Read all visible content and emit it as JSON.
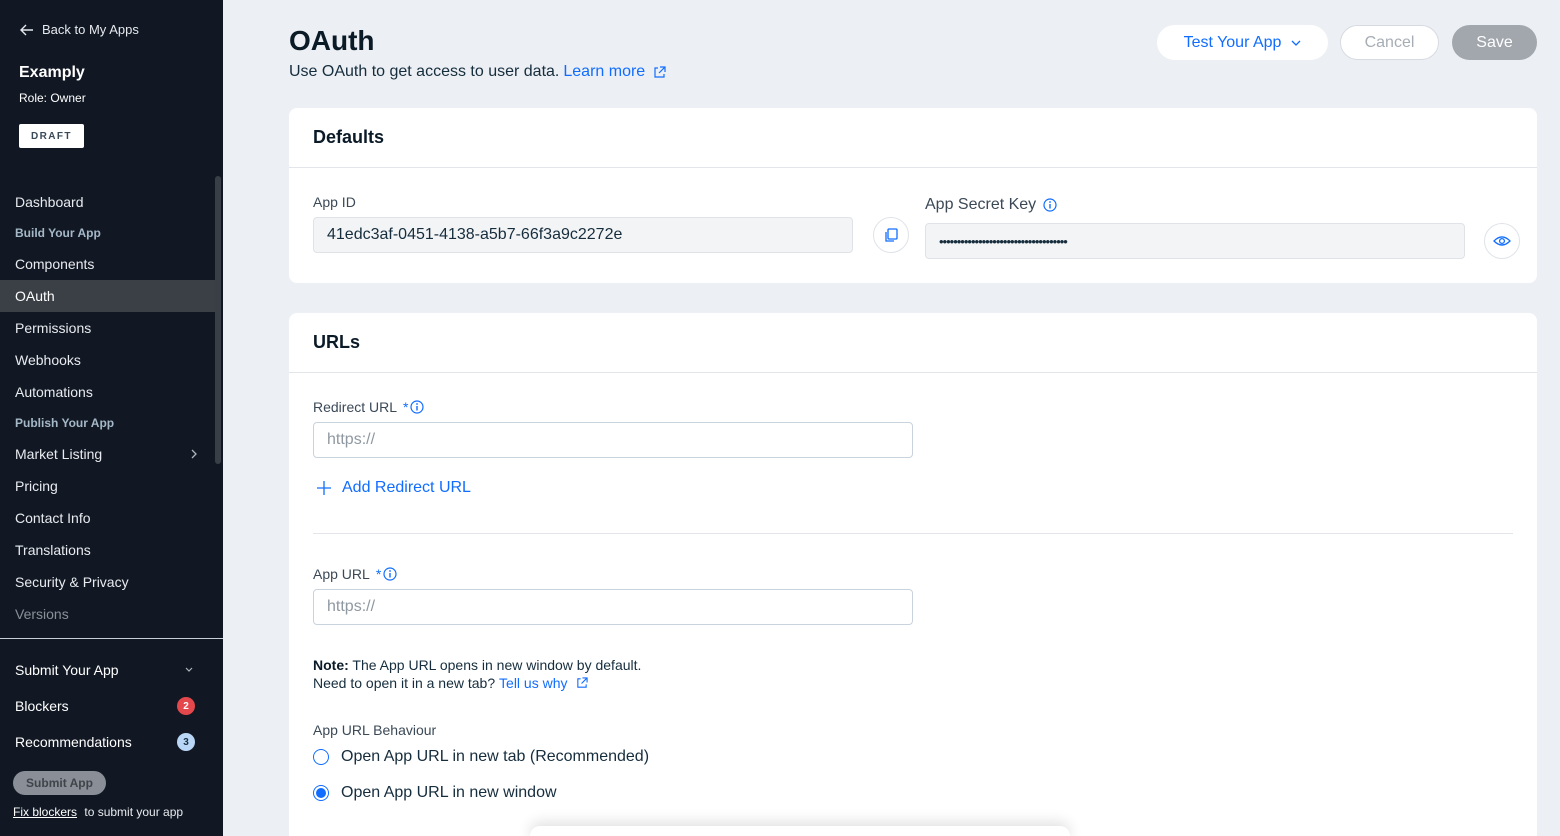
{
  "sidebar": {
    "back_label": "Back to My Apps",
    "app_name": "Examply",
    "role": "Role: Owner",
    "status_badge": "DRAFT",
    "dashboard": "Dashboard",
    "section_build": "Build Your App",
    "items_build": [
      "Components",
      "OAuth",
      "Permissions",
      "Webhooks",
      "Automations"
    ],
    "section_publish": "Publish Your App",
    "items_publish": [
      "Market Listing",
      "Pricing",
      "Contact Info",
      "Translations",
      "Security & Privacy",
      "Versions"
    ],
    "active_item": "OAuth",
    "submit_your_app": "Submit Your App",
    "blockers_label": "Blockers",
    "blockers_count": "2",
    "recommendations_label": "Recommendations",
    "recommendations_count": "3",
    "submit_button": "Submit App",
    "fix_blockers_link": "Fix blockers",
    "fix_blockers_suffix": "to submit your app"
  },
  "header": {
    "title": "OAuth",
    "subtitle": "Use OAuth to get access to user data.",
    "learn_more": "Learn more",
    "test_button": "Test Your App",
    "cancel_button": "Cancel",
    "save_button": "Save"
  },
  "defaults_card": {
    "title": "Defaults",
    "app_id_label": "App ID",
    "app_id_value": "41edc3af-0451-4138-a5b7-66f3a9c2272e",
    "secret_label": "App Secret Key",
    "secret_value": "••••••••••••••••••••••••••••••••••••"
  },
  "urls_card": {
    "title": "URLs",
    "redirect_label": "Redirect URL",
    "required_mark": "*",
    "redirect_placeholder": "https://",
    "add_redirect": "Add Redirect URL",
    "app_url_label": "App URL",
    "app_url_placeholder": "https://",
    "note_bold": "Note:",
    "note_text": "The App URL opens in new window by default.",
    "note_line2": "Need to open it in a new tab?",
    "tell_us": "Tell us why",
    "behaviour_label": "App URL Behaviour",
    "option_new_tab": "Open App URL in new tab (Recommended)",
    "option_new_window": "Open App URL in new window",
    "selected_option": "Open App URL in new window"
  },
  "colors": {
    "accent": "#116dff",
    "sidebar_bg": "#111823",
    "page_bg": "#eceff3",
    "blocker_badge": "#e4484c"
  }
}
